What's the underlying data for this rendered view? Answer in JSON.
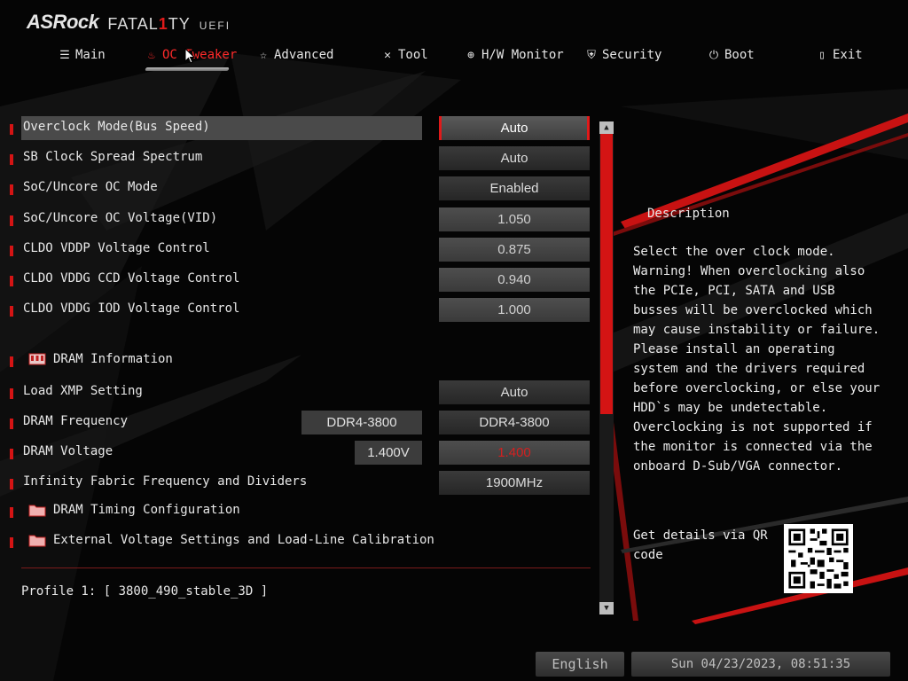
{
  "brand": {
    "name": "ASRock",
    "series_pre": "FATAL",
    "series_one": "1",
    "series_post": "TY",
    "uefi": "UEFI"
  },
  "nav": {
    "items": [
      {
        "label": "Main",
        "icon": "list-icon"
      },
      {
        "label": "OC Tweaker",
        "icon": "flame-icon",
        "active": true
      },
      {
        "label": "Advanced",
        "icon": "star-icon"
      },
      {
        "label": "Tool",
        "icon": "tools-icon"
      },
      {
        "label": "H/W Monitor",
        "icon": "crosshair-icon"
      },
      {
        "label": "Security",
        "icon": "shield-icon"
      },
      {
        "label": "Boot",
        "icon": "power-icon"
      },
      {
        "label": "Exit",
        "icon": "exit-door-icon"
      }
    ]
  },
  "settings": {
    "overclock_mode": {
      "label": "Overclock Mode(Bus Speed)",
      "value": "Auto"
    },
    "sb_clock": {
      "label": "SB Clock Spread Spectrum",
      "value": "Auto"
    },
    "soc_oc_mode": {
      "label": "SoC/Uncore OC Mode",
      "value": "Enabled"
    },
    "soc_oc_voltage": {
      "label": "SoC/Uncore OC Voltage(VID)",
      "value": "1.050"
    },
    "cldo_vddp": {
      "label": "CLDO VDDP Voltage Control",
      "value": "0.875"
    },
    "cldo_vddg_ccd": {
      "label": "CLDO VDDG CCD Voltage Control",
      "value": "0.940"
    },
    "cldo_vddg_iod": {
      "label": "CLDO VDDG IOD Voltage Control",
      "value": "1.000"
    },
    "dram_info": {
      "label": "DRAM Information"
    },
    "load_xmp": {
      "label": "Load XMP Setting",
      "value": "Auto"
    },
    "dram_freq": {
      "label": "DRAM Frequency",
      "current": "DDR4-3800",
      "value": "DDR4-3800"
    },
    "dram_voltage": {
      "label": "DRAM Voltage",
      "current": "1.400V",
      "value": "1.400"
    },
    "infinity_fabric": {
      "label": "Infinity Fabric Frequency and Dividers",
      "value": "1900MHz"
    },
    "dram_timing": {
      "label": "DRAM Timing Configuration"
    },
    "ext_voltage": {
      "label": "External Voltage Settings and Load-Line Calibration"
    }
  },
  "profile": "Profile 1: [ 3800_490_stable_3D ]",
  "description": {
    "title": "Description",
    "text": "Select the over clock mode.\nWarning! When overclocking also\nthe PCIe, PCI, SATA and USB\nbusses will be overclocked which\nmay cause instability or failure.\nPlease install an operating\nsystem and the drivers required\nbefore overclocking, or else your\nHDD`s may be undetectable.\nOverclocking is not supported if\nthe monitor is connected via the\nonboard D-Sub/VGA connector.",
    "qr_text": "Get details via QR code"
  },
  "footer": {
    "language": "English",
    "datetime": "Sun 04/23/2023, 08:51:35"
  },
  "colors": {
    "accent": "#d41414",
    "background": "#050505",
    "panel": "#3a3a3a"
  }
}
